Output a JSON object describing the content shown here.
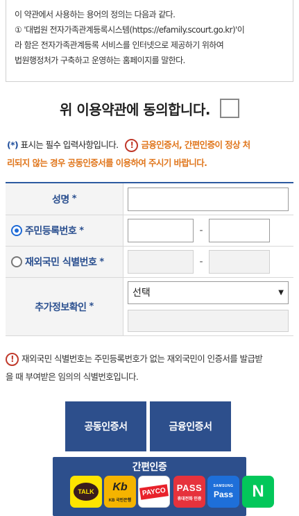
{
  "terms": {
    "line1": "이 약관에서 사용하는 용어의 정의는 다음과 같다.",
    "line2": "① '대법원 전자가족관계등록시스템(https://efamily.scourt.go.kr)'이",
    "line3": "라 함은 전자가족관계등록 서비스를 인터넷으로 제공하기 위하여",
    "line4": "법원행정처가 구축하고 운영하는 홈페이지를 말한다."
  },
  "agree": {
    "label": "위 이용약관에 동의합니다."
  },
  "notice_required": {
    "star": "(*)",
    "text": " 표시는 필수 입력사항입니다.",
    "icon": "!",
    "warning_line1": "금융인증서, 간편인증이 정상 처",
    "warning_line2": "리되지 않는 경우 공동인증서를 이용하여 주시기 바랍니다."
  },
  "form": {
    "name_label": "성명",
    "star": "*",
    "rrn_label": "주민등록번호",
    "foreigner_label": "재외국민 식별번호",
    "extra_label": "추가정보확인",
    "dash": "-",
    "select_value": "선택"
  },
  "notice_foreigner": {
    "icon": "!",
    "line1": "재외국민 식별번호는 주민등록번호가 없는 재외국민이 인증서를 발급받",
    "line2": "을 때 부여받은 임의의 식별번호입니다."
  },
  "buttons": {
    "joint_cert": "공동인증서",
    "financial_cert": "금융인증서",
    "simple_auth": "간편인증"
  },
  "simple_auth_providers": {
    "kakao": "TALK",
    "kb_mark": "Kb",
    "kb": "KB 국민은행",
    "payco": "PAYCO",
    "pass": "PASS",
    "pass_sub": "휴대전화 인증",
    "samsung_top": "SAMSUNG",
    "samsung": "Pass",
    "naver": "N"
  },
  "colors": {
    "primary": "#2d4f8c",
    "warning": "#e0761c",
    "kakao": "#fee500",
    "kb": "#f5b400",
    "payco": "#e8222b",
    "pass": "#e6323c",
    "samsung": "#1e6fd9",
    "naver": "#03c75a"
  }
}
